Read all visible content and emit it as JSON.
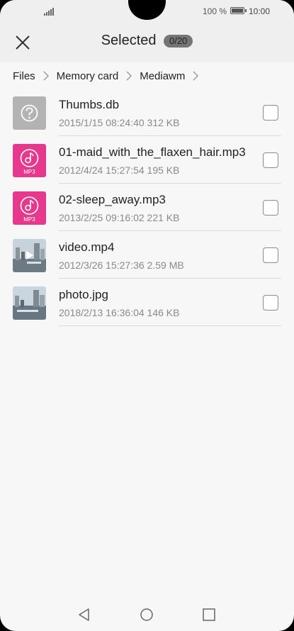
{
  "status_bar": {
    "battery_percent": "100 %",
    "time": "10:00"
  },
  "header": {
    "title": "Selected",
    "count": "0/20"
  },
  "breadcrumb": [
    "Files",
    "Memory card",
    "Mediawm"
  ],
  "files": [
    {
      "name": "Thumbs.db",
      "meta": "2015/1/15 08:24:40 312 KB",
      "icon": "unknown-file-icon",
      "checked": false
    },
    {
      "name": "01-maid_with_the_flaxen_hair.mp3",
      "meta": "2012/4/24 15:27:54 195 KB",
      "icon": "mp3-icon",
      "icon_label": "MP3",
      "checked": false
    },
    {
      "name": "02-sleep_away.mp3",
      "meta": "2013/2/25 09:16:02 221 KB",
      "icon": "mp3-icon",
      "icon_label": "MP3",
      "checked": false
    },
    {
      "name": "video.mp4",
      "meta": "2012/3/26 15:27:36 2.59 MB",
      "icon": "video-thumbnail",
      "checked": false
    },
    {
      "name": "photo.jpg",
      "meta": "2018/2/13 16:36:04 146 KB",
      "icon": "photo-thumbnail",
      "checked": false
    }
  ],
  "colors": {
    "audio_accent": "#e6398e",
    "unknown_file": "#b3b3b3",
    "badge": "#757575"
  },
  "nav": {
    "back": "back-icon",
    "home": "home-icon",
    "recents": "recents-icon"
  }
}
